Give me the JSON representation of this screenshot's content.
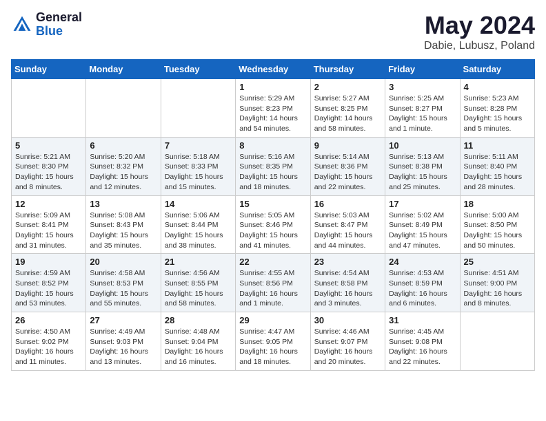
{
  "header": {
    "logo_general": "General",
    "logo_blue": "Blue",
    "month_title": "May 2024",
    "location": "Dabie, Lubusz, Poland"
  },
  "days_of_week": [
    "Sunday",
    "Monday",
    "Tuesday",
    "Wednesday",
    "Thursday",
    "Friday",
    "Saturday"
  ],
  "weeks": [
    [
      {
        "day": "",
        "info": ""
      },
      {
        "day": "",
        "info": ""
      },
      {
        "day": "",
        "info": ""
      },
      {
        "day": "1",
        "info": "Sunrise: 5:29 AM\nSunset: 8:23 PM\nDaylight: 14 hours\nand 54 minutes."
      },
      {
        "day": "2",
        "info": "Sunrise: 5:27 AM\nSunset: 8:25 PM\nDaylight: 14 hours\nand 58 minutes."
      },
      {
        "day": "3",
        "info": "Sunrise: 5:25 AM\nSunset: 8:27 PM\nDaylight: 15 hours\nand 1 minute."
      },
      {
        "day": "4",
        "info": "Sunrise: 5:23 AM\nSunset: 8:28 PM\nDaylight: 15 hours\nand 5 minutes."
      }
    ],
    [
      {
        "day": "5",
        "info": "Sunrise: 5:21 AM\nSunset: 8:30 PM\nDaylight: 15 hours\nand 8 minutes."
      },
      {
        "day": "6",
        "info": "Sunrise: 5:20 AM\nSunset: 8:32 PM\nDaylight: 15 hours\nand 12 minutes."
      },
      {
        "day": "7",
        "info": "Sunrise: 5:18 AM\nSunset: 8:33 PM\nDaylight: 15 hours\nand 15 minutes."
      },
      {
        "day": "8",
        "info": "Sunrise: 5:16 AM\nSunset: 8:35 PM\nDaylight: 15 hours\nand 18 minutes."
      },
      {
        "day": "9",
        "info": "Sunrise: 5:14 AM\nSunset: 8:36 PM\nDaylight: 15 hours\nand 22 minutes."
      },
      {
        "day": "10",
        "info": "Sunrise: 5:13 AM\nSunset: 8:38 PM\nDaylight: 15 hours\nand 25 minutes."
      },
      {
        "day": "11",
        "info": "Sunrise: 5:11 AM\nSunset: 8:40 PM\nDaylight: 15 hours\nand 28 minutes."
      }
    ],
    [
      {
        "day": "12",
        "info": "Sunrise: 5:09 AM\nSunset: 8:41 PM\nDaylight: 15 hours\nand 31 minutes."
      },
      {
        "day": "13",
        "info": "Sunrise: 5:08 AM\nSunset: 8:43 PM\nDaylight: 15 hours\nand 35 minutes."
      },
      {
        "day": "14",
        "info": "Sunrise: 5:06 AM\nSunset: 8:44 PM\nDaylight: 15 hours\nand 38 minutes."
      },
      {
        "day": "15",
        "info": "Sunrise: 5:05 AM\nSunset: 8:46 PM\nDaylight: 15 hours\nand 41 minutes."
      },
      {
        "day": "16",
        "info": "Sunrise: 5:03 AM\nSunset: 8:47 PM\nDaylight: 15 hours\nand 44 minutes."
      },
      {
        "day": "17",
        "info": "Sunrise: 5:02 AM\nSunset: 8:49 PM\nDaylight: 15 hours\nand 47 minutes."
      },
      {
        "day": "18",
        "info": "Sunrise: 5:00 AM\nSunset: 8:50 PM\nDaylight: 15 hours\nand 50 minutes."
      }
    ],
    [
      {
        "day": "19",
        "info": "Sunrise: 4:59 AM\nSunset: 8:52 PM\nDaylight: 15 hours\nand 53 minutes."
      },
      {
        "day": "20",
        "info": "Sunrise: 4:58 AM\nSunset: 8:53 PM\nDaylight: 15 hours\nand 55 minutes."
      },
      {
        "day": "21",
        "info": "Sunrise: 4:56 AM\nSunset: 8:55 PM\nDaylight: 15 hours\nand 58 minutes."
      },
      {
        "day": "22",
        "info": "Sunrise: 4:55 AM\nSunset: 8:56 PM\nDaylight: 16 hours\nand 1 minute."
      },
      {
        "day": "23",
        "info": "Sunrise: 4:54 AM\nSunset: 8:58 PM\nDaylight: 16 hours\nand 3 minutes."
      },
      {
        "day": "24",
        "info": "Sunrise: 4:53 AM\nSunset: 8:59 PM\nDaylight: 16 hours\nand 6 minutes."
      },
      {
        "day": "25",
        "info": "Sunrise: 4:51 AM\nSunset: 9:00 PM\nDaylight: 16 hours\nand 8 minutes."
      }
    ],
    [
      {
        "day": "26",
        "info": "Sunrise: 4:50 AM\nSunset: 9:02 PM\nDaylight: 16 hours\nand 11 minutes."
      },
      {
        "day": "27",
        "info": "Sunrise: 4:49 AM\nSunset: 9:03 PM\nDaylight: 16 hours\nand 13 minutes."
      },
      {
        "day": "28",
        "info": "Sunrise: 4:48 AM\nSunset: 9:04 PM\nDaylight: 16 hours\nand 16 minutes."
      },
      {
        "day": "29",
        "info": "Sunrise: 4:47 AM\nSunset: 9:05 PM\nDaylight: 16 hours\nand 18 minutes."
      },
      {
        "day": "30",
        "info": "Sunrise: 4:46 AM\nSunset: 9:07 PM\nDaylight: 16 hours\nand 20 minutes."
      },
      {
        "day": "31",
        "info": "Sunrise: 4:45 AM\nSunset: 9:08 PM\nDaylight: 16 hours\nand 22 minutes."
      },
      {
        "day": "",
        "info": ""
      }
    ]
  ]
}
